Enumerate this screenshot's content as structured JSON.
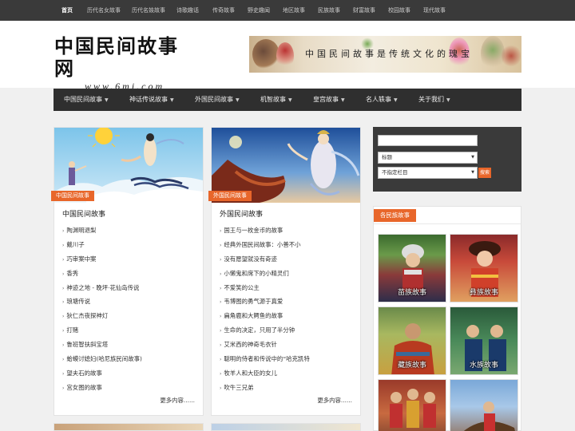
{
  "topbar": {
    "items": [
      "首页",
      "历代名女故事",
      "历代名妓故事",
      "诗歌趣话",
      "传奇故事",
      "野史趣闻",
      "地区故事",
      "民族故事",
      "财富故事",
      "校园故事",
      "现代故事"
    ]
  },
  "header": {
    "logo_title": "中国民间故事网",
    "logo_url": "www.6mj.com",
    "banner_slogan": "中国民间故事是传统文化的瑰宝"
  },
  "nav": {
    "items": [
      "中国民间故事",
      "神话传说故事",
      "外国民间故事",
      "机智故事",
      "皇宫故事",
      "名人轶事",
      "关于我们"
    ]
  },
  "cards": [
    {
      "category": "中国民间故事",
      "title": "中国民间故事",
      "items": [
        "陶渊明退梨",
        "戴川子",
        "巧审案中案",
        "香秀",
        "神迹之地 - 晚坪·花仙岛传说",
        "琅塘传说",
        "狄仁杰夜探神灯",
        "打赌",
        "鲁班智扶斜宝塔",
        "蛤蟆讨媳妇(哈尼族民间故事)",
        "望夫石的故事",
        "宫女图的故事"
      ],
      "more": "更多内容......"
    },
    {
      "category": "外国民间故事",
      "title": "外国民间故事",
      "items": [
        "国王与一枚金币的故事",
        "经典外国民间故事：小善不小",
        "没有愿望就没有奇迹",
        "小懒鬼和席下的小精灵们",
        "不爱笑的公主",
        "韦博图的勇气源于真爱",
        "扁角鹿和大鳄鱼的故事",
        "生命的决定，只用了半分钟",
        "艾米西的神奇毛衣针",
        "聪明的侍者和传说中的“哈克凯特",
        "牧羊人和大臣的女儿",
        "吹牛三兄弟"
      ],
      "more": "更多内容......"
    }
  ],
  "search": {
    "input_value": "",
    "field_select": "标题",
    "column_select": "不指定栏目",
    "button_label": "搜索"
  },
  "ethnic": {
    "header": "各民族故事",
    "thumbs": [
      "苗族故事",
      "彝族故事",
      "藏族故事",
      "水族故事",
      "",
      ""
    ]
  },
  "colors": {
    "accent": "#e8662a",
    "topbar": "#3a3a3a",
    "nav": "#2f2f2f"
  }
}
